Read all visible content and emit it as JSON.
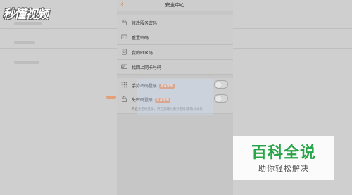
{
  "watermark": {
    "logo": "秒懂视频"
  },
  "nav": {
    "back_icon": "chevron-left-icon",
    "title": "安全中心"
  },
  "menu": [
    {
      "icon": "lock-icon",
      "label": "修改服务密码"
    },
    {
      "icon": "reset-icon",
      "label": "重置密码"
    },
    {
      "icon": "puk-icon",
      "label": "我的PUK码"
    },
    {
      "icon": "card-icon",
      "label": "找回上网卡号码"
    }
  ],
  "toggles": [
    {
      "icon": "grid-icon",
      "label": "手势密码登录",
      "badge": "建议使用",
      "on": false
    },
    {
      "icon": "lock-icon",
      "label": "免密码登录",
      "badge": "建议使用",
      "on": false
    }
  ],
  "hint": "开启免密码登录，开启需输入服务密码(需确认本机)",
  "brand": {
    "title": "百科全说",
    "subtitle": "助你轻松解决"
  },
  "colors": {
    "accent": "#e07a2a",
    "brand_green": "#27a447",
    "badge": "#e2895a"
  }
}
